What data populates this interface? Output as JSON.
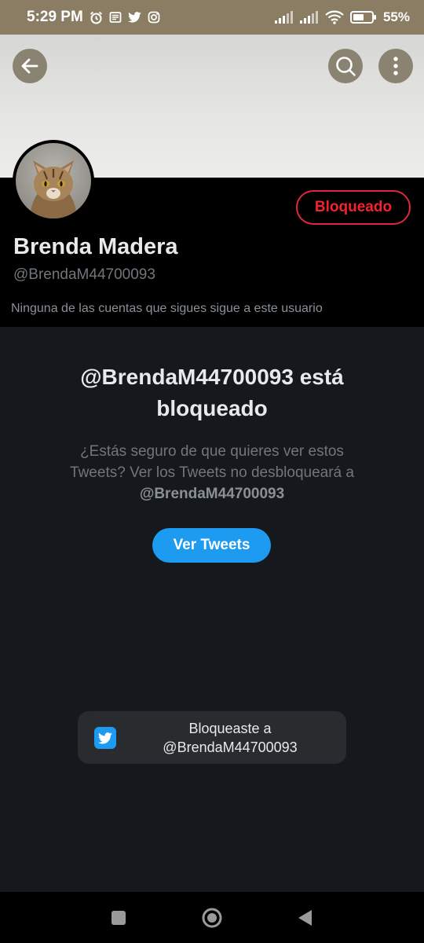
{
  "status_bar": {
    "time": "5:29 PM",
    "battery": "55%",
    "icons_left": [
      "alarm-icon",
      "news-icon",
      "twitter-icon",
      "instagram-icon"
    ],
    "icons_right": [
      "signal-icon",
      "signal-icon",
      "wifi-icon",
      "battery-icon"
    ]
  },
  "header": {
    "back_icon": "arrow-left-icon",
    "search_icon": "search-icon",
    "more_icon": "more-vertical-icon"
  },
  "profile": {
    "display_name": "Brenda Madera",
    "handle": "@BrendaM44700093",
    "followers_note": "Ninguna de las cuentas que sigues sigue a este usuario",
    "blocked_button_label": "Bloqueado",
    "avatar": "cat-avatar"
  },
  "blocked_notice": {
    "title_line1": "@BrendaM44700093 está",
    "title_line2": "bloqueado",
    "description_line1": "¿Estás seguro de que quieres ver estos",
    "description_line2": "Tweets? Ver los Tweets no desbloqueará a",
    "description_handle": "@BrendaM44700093",
    "view_tweets_label": "Ver Tweets"
  },
  "toast": {
    "line1": "Bloqueaste a",
    "line2": "@BrendaM44700093",
    "icon": "twitter-icon"
  },
  "colors": {
    "accent": "#1d9bf0",
    "blocked_red": "#f4212e",
    "status_bar_bg": "#8a7d63",
    "background": "#15181d"
  },
  "nav_bar": {
    "buttons": [
      "recents-square-icon",
      "home-circle-icon",
      "back-triangle-icon"
    ]
  }
}
